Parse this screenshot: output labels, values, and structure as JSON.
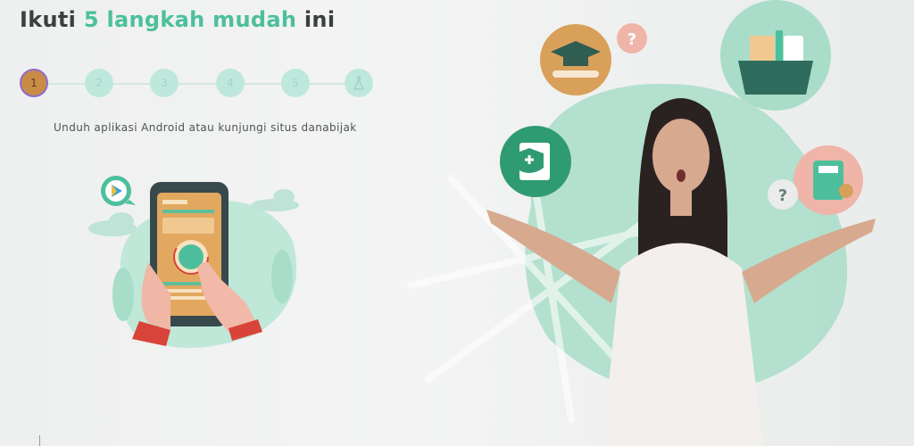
{
  "title": {
    "prefix": "Ikuti",
    "highlight": "5 langkah mudah",
    "suffix": "ini"
  },
  "steps": [
    {
      "label": "1",
      "active": true
    },
    {
      "label": "2",
      "active": false
    },
    {
      "label": "3",
      "active": false
    },
    {
      "label": "4",
      "active": false
    },
    {
      "label": "5",
      "active": false
    },
    {
      "label": "",
      "icon": "flask-icon",
      "active": false
    }
  ],
  "description": "Unduh aplikasi Android atau kunjungi situs danabijak",
  "colors": {
    "accent": "#4dbf9c",
    "active_step": "#c98c47",
    "step": "#bfe8dc",
    "title": "#3a3f40"
  },
  "icons": [
    "play-store-icon",
    "graduation-cap-icon",
    "question-icon",
    "shopping-basket-icon",
    "health-insurance-icon",
    "calculator-icon",
    "cloud-icon",
    "phone-icon",
    "flask-icon"
  ]
}
